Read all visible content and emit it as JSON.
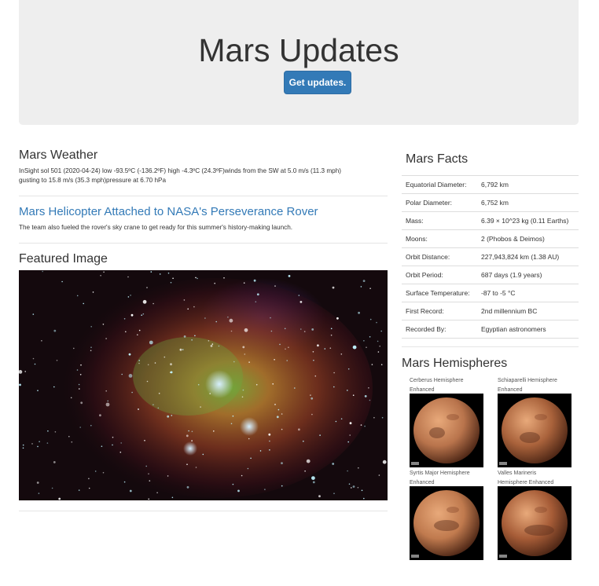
{
  "header": {
    "title": "Mars Updates",
    "button_label": "Get updates."
  },
  "weather": {
    "heading": "Mars Weather",
    "line1": "InSight sol 501 (2020-04-24) low -93.5ºC (-136.2ºF) high -4.3ºC (24.3ºF)winds from the SW at 5.0 m/s (11.3 mph)",
    "line2": "gusting to 15.8 m/s (35.3 mph)pressure at 6.70 hPa"
  },
  "news": {
    "title": "Mars Helicopter Attached to NASA's Perseverance Rover",
    "paragraph": "The team also fueled the rover's sky crane to get ready for this summer's history-making launch."
  },
  "featured": {
    "heading": "Featured Image"
  },
  "facts": {
    "heading": "Mars Facts",
    "rows": [
      {
        "label": "Equatorial Diameter:",
        "value": "6,792 km"
      },
      {
        "label": "Polar Diameter:",
        "value": "6,752 km"
      },
      {
        "label": "Mass:",
        "value": "6.39 × 10^23 kg (0.11 Earths)"
      },
      {
        "label": "Moons:",
        "value": "2 (Phobos & Deimos)"
      },
      {
        "label": "Orbit Distance:",
        "value": "227,943,824 km (1.38 AU)"
      },
      {
        "label": "Orbit Period:",
        "value": "687 days (1.9 years)"
      },
      {
        "label": "Surface Temperature:",
        "value": "-87 to -5 °C"
      },
      {
        "label": "First Record:",
        "value": "2nd millennium BC"
      },
      {
        "label": "Recorded By:",
        "value": "Egyptian astronomers"
      }
    ]
  },
  "hemispheres": {
    "heading": "Mars Hemispheres",
    "items": [
      {
        "line1": "Cerberus Hemisphere",
        "line2": "Enhanced",
        "color": "#b9744c"
      },
      {
        "line1": "Schiaparelli Hemisphere",
        "line2": "Enhanced",
        "color": "#a9623b"
      },
      {
        "line1": "Syrtis Major Hemisphere",
        "line2": "Enhanced",
        "color": "#c07a4e"
      },
      {
        "line1": "Valles Marineris",
        "line2": "Hemisphere Enhanced",
        "color": "#a65c37"
      }
    ]
  },
  "colors": {
    "accent": "#337ab7",
    "jumbotron": "#eeeeee",
    "border": "#dddddd"
  }
}
